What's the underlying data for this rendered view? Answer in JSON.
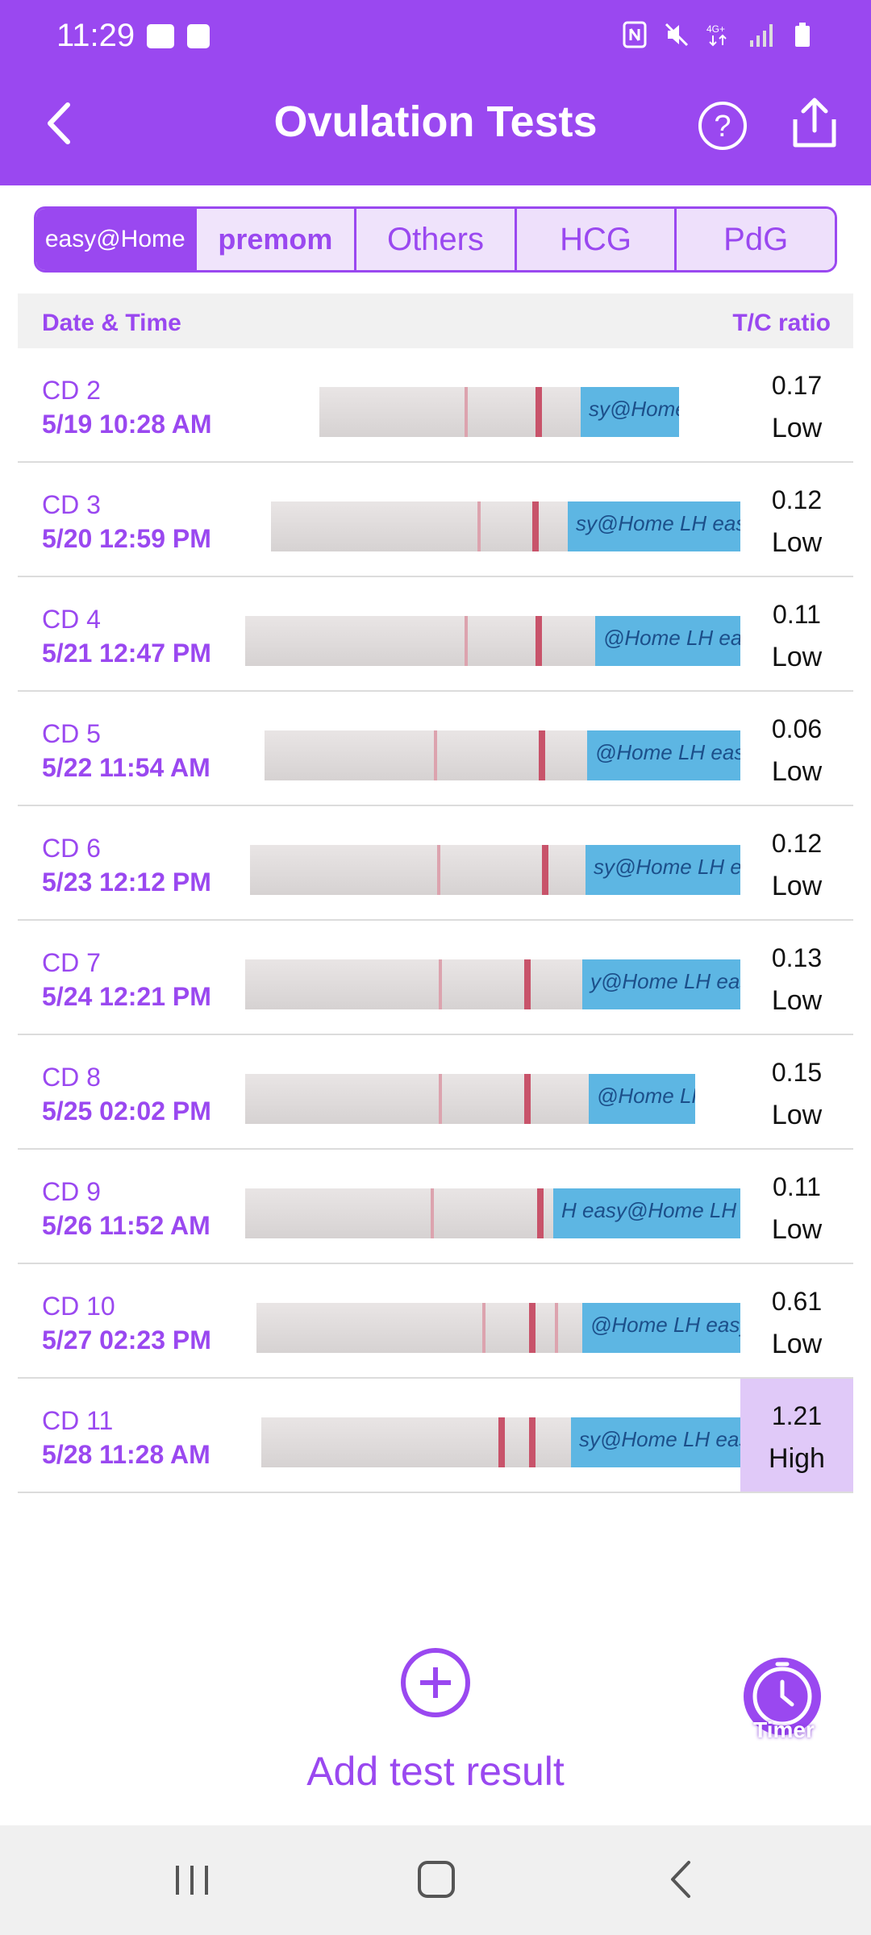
{
  "status_bar": {
    "time": "11:29"
  },
  "header": {
    "title": "Ovulation Tests"
  },
  "tabs": [
    {
      "label": "easy@Home"
    },
    {
      "label": "premom"
    },
    {
      "label": "Others"
    },
    {
      "label": "HCG"
    },
    {
      "label": "PdG"
    }
  ],
  "table": {
    "col_left": "Date & Time",
    "col_right": "T/C ratio",
    "rows": [
      {
        "cd": "CD 2",
        "datetime": "5/19  10:28 AM",
        "ratio": "0.17",
        "level": "Low",
        "strip_text": "sy@Home LH"
      },
      {
        "cd": "CD 3",
        "datetime": "5/20  12:59 PM",
        "ratio": "0.12",
        "level": "Low",
        "strip_text": "sy@Home LH easy@"
      },
      {
        "cd": "CD 4",
        "datetime": "5/21  12:47 PM",
        "ratio": "0.11",
        "level": "Low",
        "strip_text": "@Home LH easy@"
      },
      {
        "cd": "CD 5",
        "datetime": "5/22  11:54 AM",
        "ratio": "0.06",
        "level": "Low",
        "strip_text": "@Home LH easy@"
      },
      {
        "cd": "CD 6",
        "datetime": "5/23  12:12 PM",
        "ratio": "0.12",
        "level": "Low",
        "strip_text": "sy@Home LH easy"
      },
      {
        "cd": "CD 7",
        "datetime": "5/24  12:21 PM",
        "ratio": "0.13",
        "level": "Low",
        "strip_text": "y@Home LH easy"
      },
      {
        "cd": "CD 8",
        "datetime": "5/25  02:02 PM",
        "ratio": "0.15",
        "level": "Low",
        "strip_text": "@Home LH"
      },
      {
        "cd": "CD 9",
        "datetime": "5/26  11:52 AM",
        "ratio": "0.11",
        "level": "Low",
        "strip_text": "H easy@Home LH"
      },
      {
        "cd": "CD 10",
        "datetime": "5/27  02:23 PM",
        "ratio": "0.61",
        "level": "Low",
        "strip_text": "@Home LH easy"
      },
      {
        "cd": "CD 11",
        "datetime": "5/28  11:28 AM",
        "ratio": "1.21",
        "level": "High",
        "strip_text": "sy@Home LH easy"
      }
    ]
  },
  "actions": {
    "add_label": "Add test result",
    "timer_label": "Timer"
  },
  "colors": {
    "primary": "#9a48f0",
    "highlight": "#e0c9f8",
    "strip_blue": "#5db6e3",
    "test_line": "#c8536a"
  }
}
